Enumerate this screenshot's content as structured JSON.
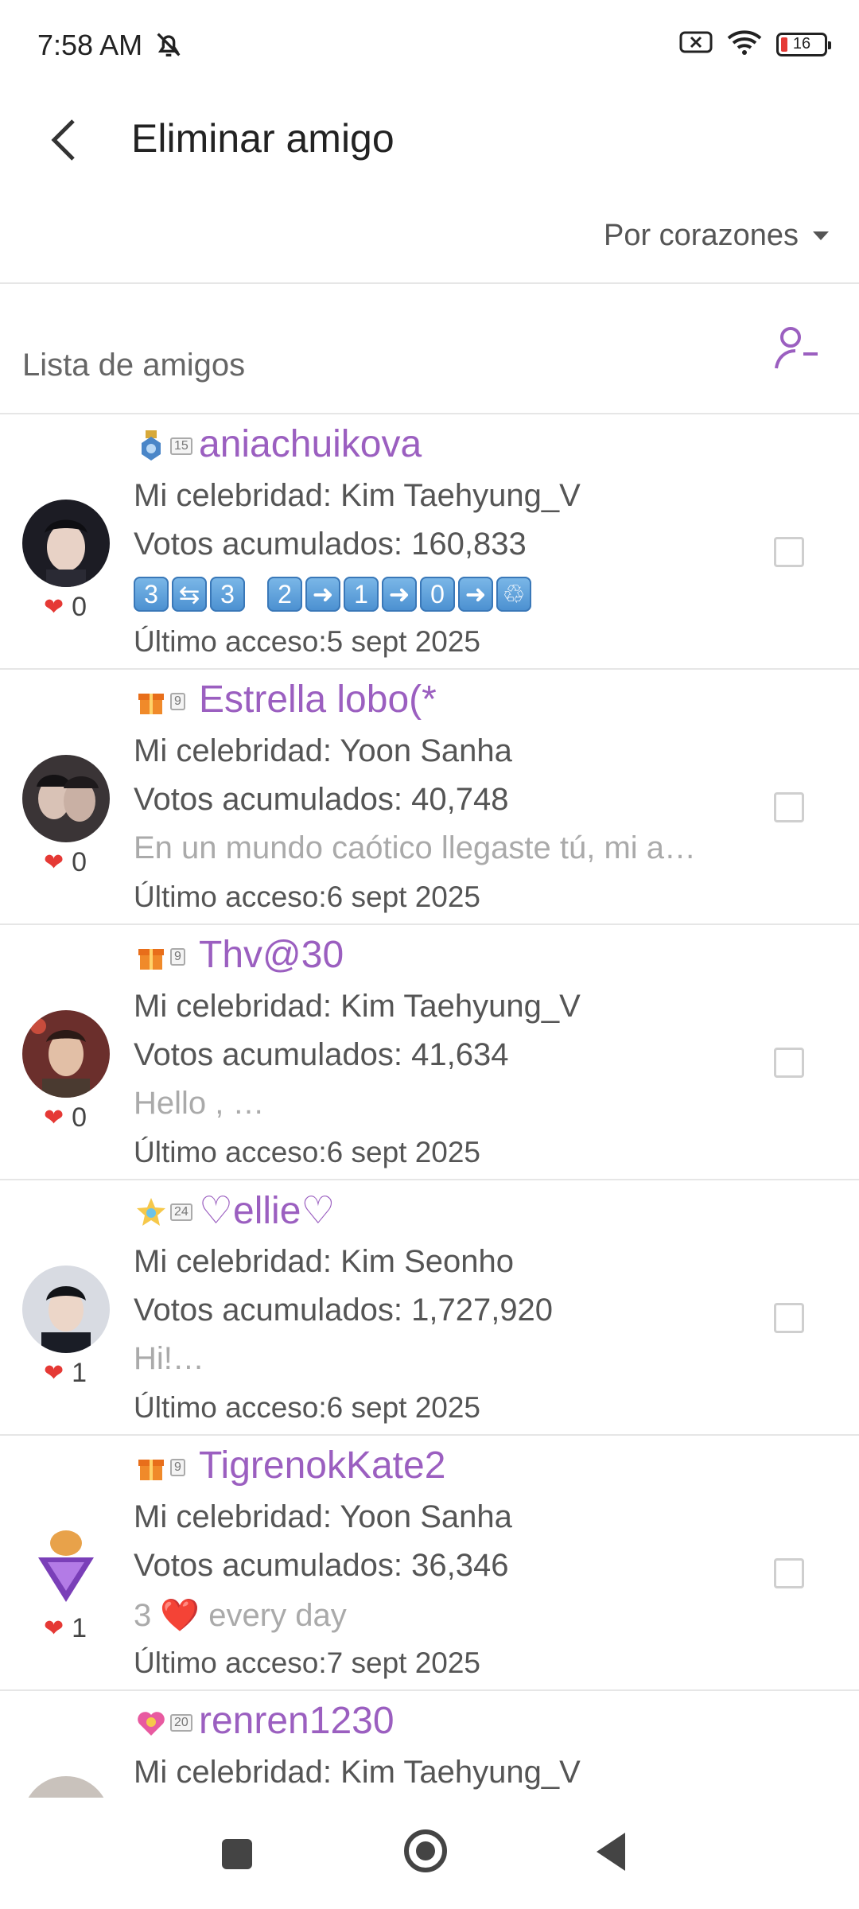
{
  "status": {
    "time": "7:58 AM",
    "battery": "16"
  },
  "header": {
    "title": "Eliminar amigo"
  },
  "sort": {
    "label": "Por corazones"
  },
  "list": {
    "title": "Lista de amigos"
  },
  "colors": {
    "accent": "#9b5fc0",
    "heart": "#e53935"
  },
  "friends": [
    {
      "name": "aniachuikova",
      "level": "15",
      "celebrity": "Mi celebridad: Kim Taehyung_V",
      "votes": "Votos acumulados: 160,833",
      "bio": "3🔄3 2➡1➡0➡🚮",
      "last": "Último acceso:5 sept 2025",
      "hearts": "0"
    },
    {
      "name": "Estrella lobo(*",
      "level": "9",
      "celebrity": "Mi celebridad: Yoon Sanha",
      "votes": "Votos acumulados: 40,748",
      "bio": "En un mundo caótico llegaste tú, mi a…",
      "last": "Último acceso:6 sept 2025",
      "hearts": "0"
    },
    {
      "name": "Thv@30",
      "level": "9",
      "celebrity": "Mi celebridad: Kim Taehyung_V",
      "votes": "Votos acumulados: 41,634",
      "bio": "Hello , …",
      "last": "Último acceso:6 sept 2025",
      "hearts": "0"
    },
    {
      "name": "♡ellie♡",
      "level": "24",
      "celebrity": "Mi celebridad: Kim Seonho",
      "votes": "Votos acumulados: 1,727,920",
      "bio": "Hi!…",
      "last": "Último acceso:6 sept 2025",
      "hearts": "1"
    },
    {
      "name": "TigrenokKate2",
      "level": "9",
      "celebrity": "Mi celebridad: Yoon Sanha",
      "votes": "Votos acumulados: 36,346",
      "bio": "3 ❤️ every day",
      "last": "Último acceso:7 sept 2025",
      "hearts": "1"
    },
    {
      "name": "renren1230",
      "level": "20",
      "celebrity": "Mi celebridad: Kim Taehyung_V",
      "votes": "",
      "bio": "",
      "last": "",
      "hearts": ""
    }
  ]
}
